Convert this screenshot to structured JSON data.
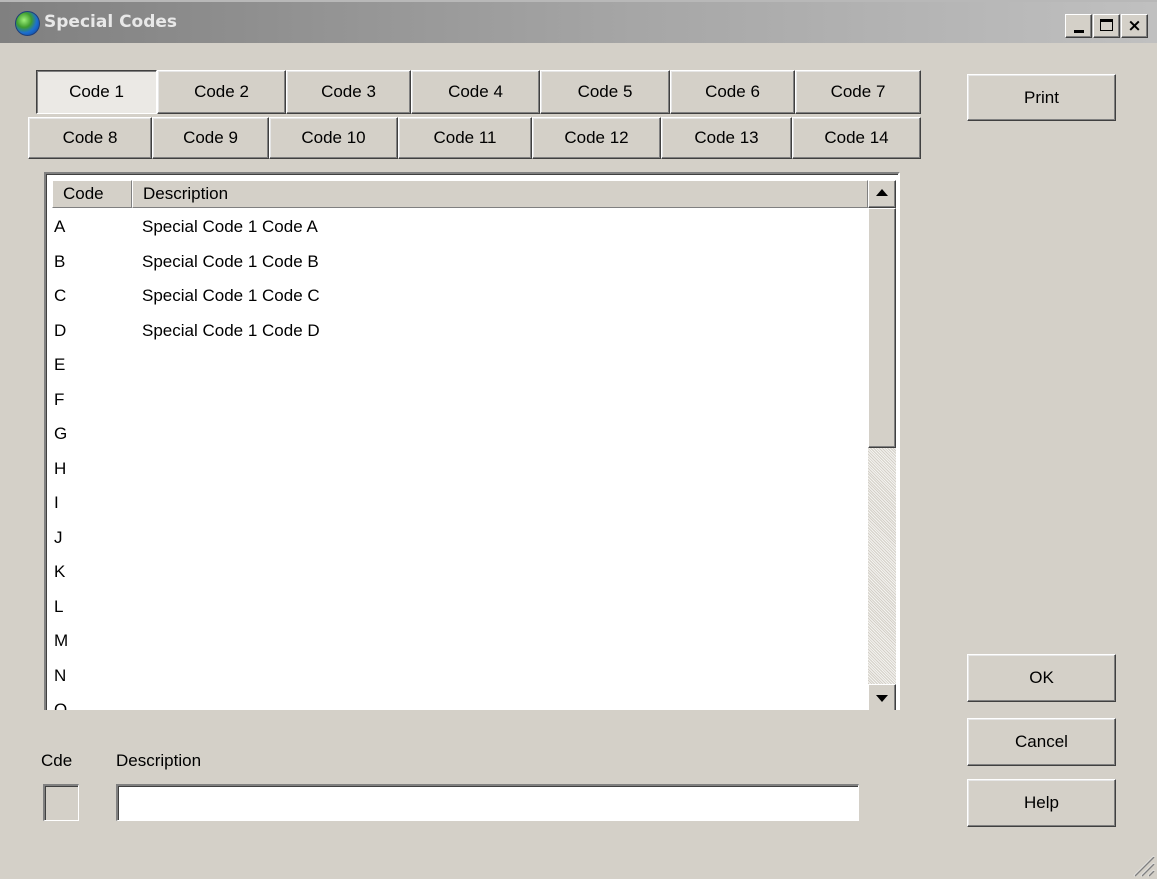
{
  "window": {
    "title": "Special Codes"
  },
  "tabs": {
    "row1": [
      "Code 1",
      "Code 2",
      "Code 3",
      "Code 4",
      "Code 5",
      "Code 6",
      "Code 7"
    ],
    "row2": [
      "Code 8",
      "Code 9",
      "Code 10",
      "Code 11",
      "Code 12",
      "Code 13",
      "Code 14"
    ],
    "selected": "Code 1"
  },
  "buttons": {
    "print": "Print",
    "ok": "OK",
    "cancel": "Cancel",
    "help": "Help"
  },
  "list": {
    "headers": {
      "code": "Code",
      "description": "Description"
    },
    "rows": [
      {
        "code": "A",
        "description": "Special Code 1 Code A"
      },
      {
        "code": "B",
        "description": "Special Code 1 Code B"
      },
      {
        "code": "C",
        "description": "Special Code 1 Code C"
      },
      {
        "code": "D",
        "description": "Special Code 1 Code D"
      },
      {
        "code": "E",
        "description": ""
      },
      {
        "code": "F",
        "description": ""
      },
      {
        "code": "G",
        "description": ""
      },
      {
        "code": "H",
        "description": ""
      },
      {
        "code": "I",
        "description": ""
      },
      {
        "code": "J",
        "description": ""
      },
      {
        "code": "K",
        "description": ""
      },
      {
        "code": "L",
        "description": ""
      },
      {
        "code": "M",
        "description": ""
      },
      {
        "code": "N",
        "description": ""
      },
      {
        "code": "O",
        "description": ""
      }
    ]
  },
  "editor": {
    "code_label": "Cde",
    "description_label": "Description",
    "code_value": "",
    "description_value": ""
  },
  "colors": {
    "face": "#d4d0c8",
    "list_background": "#ffffff",
    "title_gradient_start": "#808080"
  }
}
